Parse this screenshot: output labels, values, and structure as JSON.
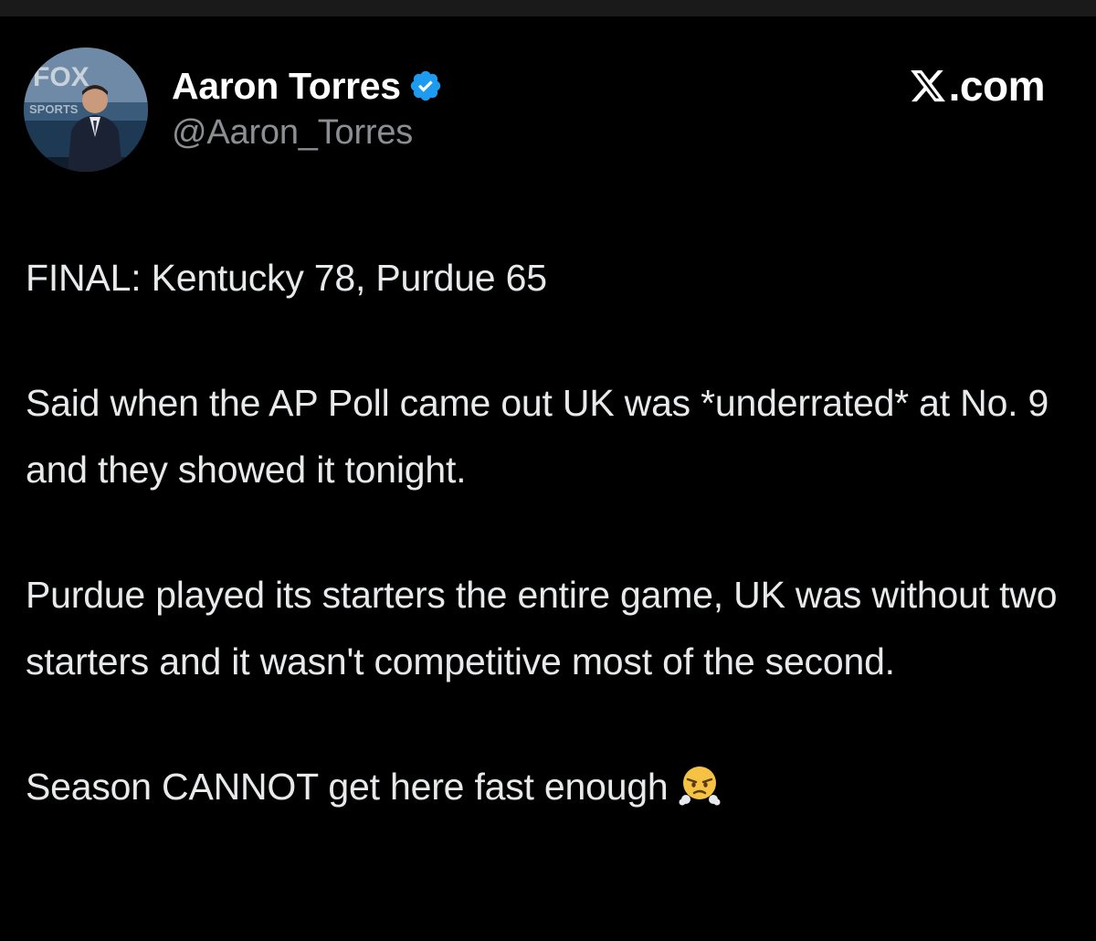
{
  "author": {
    "display_name": "Aaron Torres",
    "handle": "@Aaron_Torres",
    "verified": true,
    "avatar_logo_text": "FOX SPORTS"
  },
  "brand": {
    "text": ".com",
    "icon": "x-logo-icon"
  },
  "tweet": {
    "paragraphs": [
      "FINAL: Kentucky 78, Purdue 65",
      "Said when the AP Poll came out UK was *underrated* at No. 9 and they showed it tonight.",
      "Purdue played its starters the entire game, UK was without two starters and it wasn't competitive most of the second.",
      "Season CANNOT get here fast enough"
    ],
    "emoji": "face-with-steam-from-nose-icon"
  },
  "colors": {
    "background": "#000000",
    "text": "#e7e9ea",
    "secondary_text": "#8b8f94",
    "verified_blue": "#1d9bf0"
  }
}
